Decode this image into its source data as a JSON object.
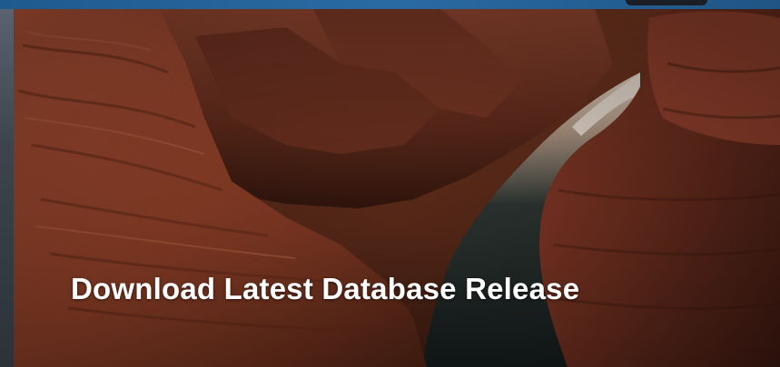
{
  "tile": {
    "title": "Download Latest Database Release",
    "background_image": "canyon-river-photo"
  },
  "colors": {
    "accent_bar": "#2a6aa3",
    "title_text": "#ffffff"
  }
}
